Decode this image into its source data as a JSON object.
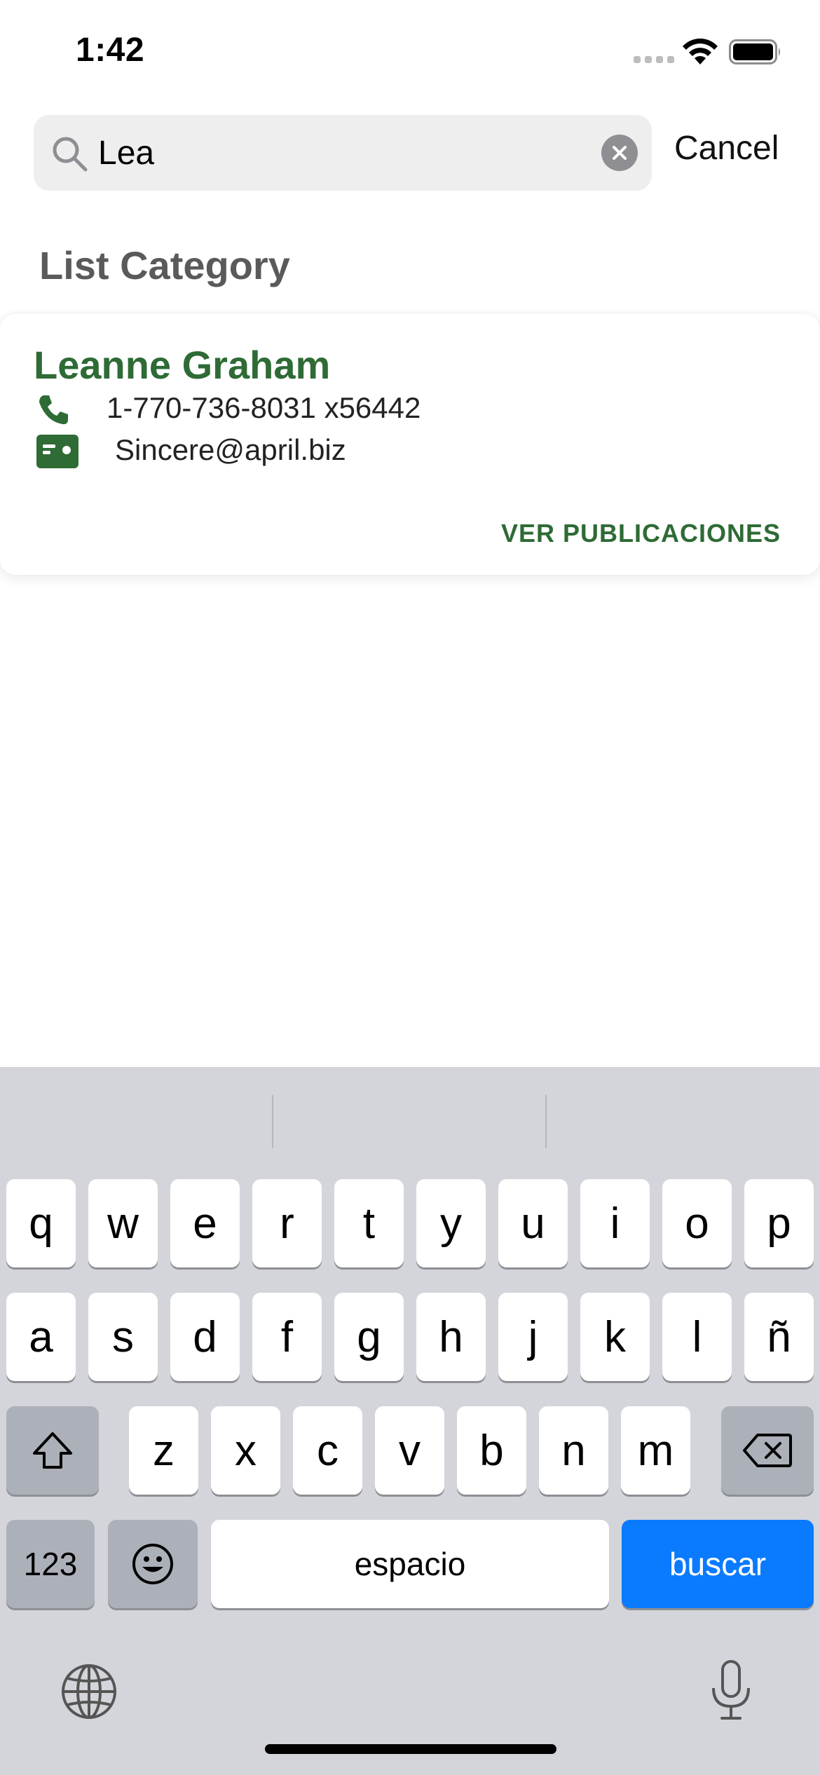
{
  "status_bar": {
    "time": "1:42"
  },
  "search": {
    "value": "Lea",
    "cancel_label": "Cancel"
  },
  "section": {
    "title": "List Category"
  },
  "users": [
    {
      "name": "Leanne Graham",
      "phone": "1-770-736-8031 x56442",
      "email": "Sincere@april.biz",
      "action_label": "VER PUBLICACIONES"
    }
  ],
  "keyboard": {
    "row1": [
      "q",
      "w",
      "e",
      "r",
      "t",
      "y",
      "u",
      "i",
      "o",
      "p"
    ],
    "row2": [
      "a",
      "s",
      "d",
      "f",
      "g",
      "h",
      "j",
      "k",
      "l",
      "ñ"
    ],
    "row3": [
      "z",
      "x",
      "c",
      "v",
      "b",
      "n",
      "m"
    ],
    "numbers_label": "123",
    "space_label": "espacio",
    "search_label": "buscar"
  },
  "colors": {
    "accent_green": "#2e6b35",
    "keyboard_blue": "#0a7aff"
  }
}
